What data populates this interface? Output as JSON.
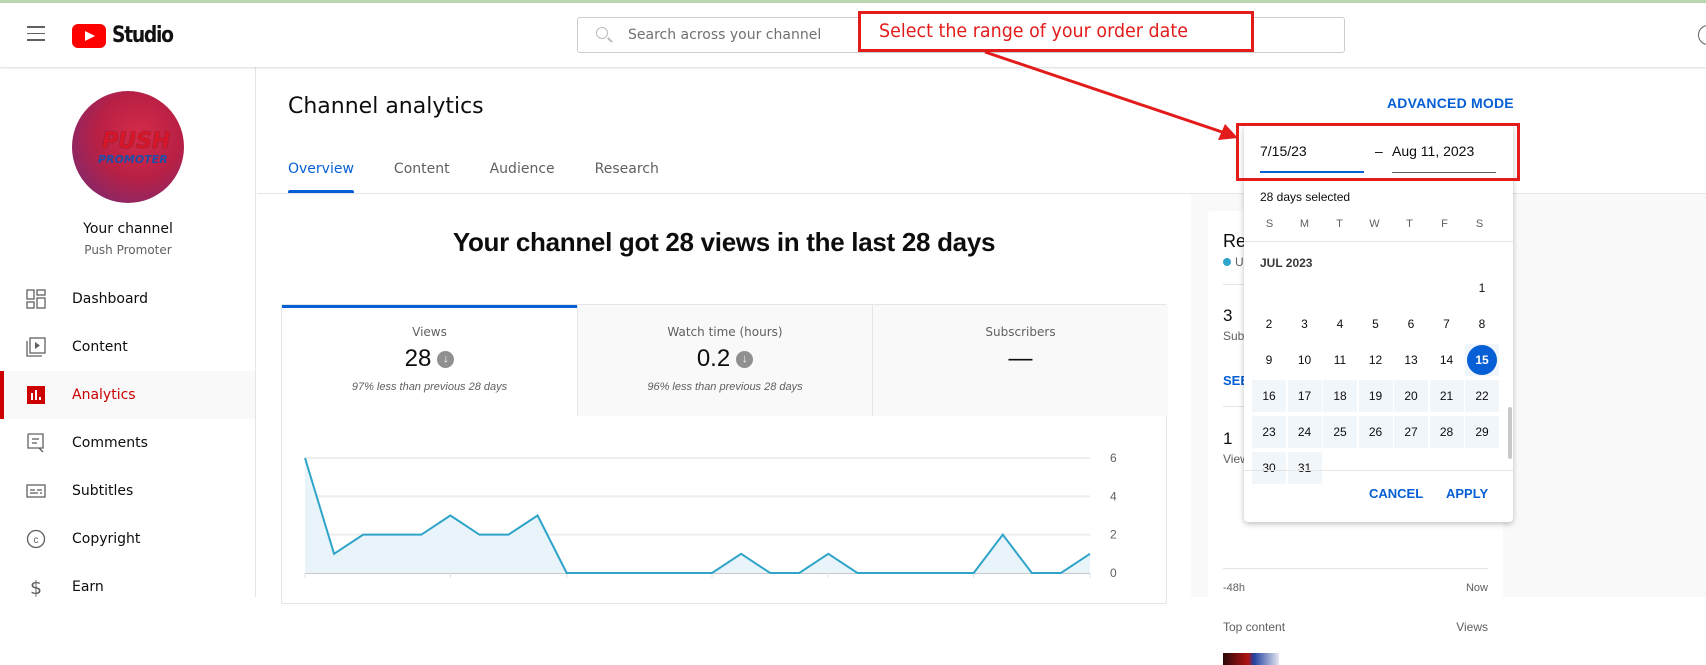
{
  "header": {
    "app_name": "Studio",
    "search_placeholder": "Search across your channel"
  },
  "annotation": {
    "text": "Select the range of your order date",
    "color": "#e31b1b"
  },
  "sidebar": {
    "channel_title": "Your channel",
    "channel_name": "Push Promoter",
    "avatar_text_1": "PUSH",
    "avatar_text_2": "PROMOTER",
    "items": [
      {
        "label": "Dashboard",
        "icon": "dashboard-icon",
        "active": false
      },
      {
        "label": "Content",
        "icon": "content-icon",
        "active": false
      },
      {
        "label": "Analytics",
        "icon": "analytics-icon",
        "active": true
      },
      {
        "label": "Comments",
        "icon": "comments-icon",
        "active": false
      },
      {
        "label": "Subtitles",
        "icon": "subtitles-icon",
        "active": false
      },
      {
        "label": "Copyright",
        "icon": "copyright-icon",
        "active": false
      },
      {
        "label": "Earn",
        "icon": "earn-icon",
        "active": false
      }
    ]
  },
  "main": {
    "title": "Channel analytics",
    "advanced_mode": "ADVANCED MODE",
    "tabs": [
      {
        "label": "Overview",
        "active": true
      },
      {
        "label": "Content",
        "active": false
      },
      {
        "label": "Audience",
        "active": false
      },
      {
        "label": "Research",
        "active": false
      }
    ],
    "headline": "Your channel got 28 views in the last 28 days",
    "metrics": [
      {
        "label": "Views",
        "value": "28",
        "trend": "down",
        "comparison": "97% less than previous 28 days"
      },
      {
        "label": "Watch time (hours)",
        "value": "0.2",
        "trend": "down",
        "comparison": "96% less than previous 28 days"
      },
      {
        "label": "Subscribers",
        "value": "—",
        "trend": "",
        "comparison": ""
      }
    ]
  },
  "realtime": {
    "title": "Re",
    "status": "Up",
    "subscribers_value": "3",
    "subscribers_label": "Sub",
    "see_more": "SEE",
    "views_value": "1",
    "views_label": "View",
    "x_start": "-48h",
    "x_end": "Now",
    "top_content_label": "Top content",
    "top_content_metric": "Views"
  },
  "date_picker": {
    "start_value": "7/15/23",
    "separator": "–",
    "end_value": "Aug 11, 2023",
    "days_selected": "28 days selected",
    "weekdays": [
      "S",
      "M",
      "T",
      "W",
      "T",
      "F",
      "S"
    ],
    "month_label": "JUL 2023",
    "month_first_weekday": 6,
    "month_days": 31,
    "selected_day": 15,
    "range_start": 15,
    "range_end": 31,
    "cancel_label": "CANCEL",
    "apply_label": "APPLY",
    "accent_color": "#065fd4"
  },
  "chart_data": {
    "type": "area",
    "title": "Views",
    "x": [
      1,
      2,
      3,
      4,
      5,
      6,
      7,
      8,
      9,
      10,
      11,
      12,
      13,
      14,
      15,
      16,
      17,
      18,
      19,
      20,
      21,
      22,
      23,
      24,
      25,
      26,
      27,
      28
    ],
    "values": [
      6,
      1,
      2,
      2,
      2,
      3,
      2,
      2,
      3,
      0,
      0,
      0,
      0,
      0,
      0,
      1,
      0,
      0,
      1,
      0,
      0,
      0,
      0,
      0,
      2,
      0,
      0,
      1
    ],
    "yticks": [
      0,
      2,
      4,
      6
    ],
    "ylim": [
      0,
      6
    ],
    "grid": true,
    "y_axis_side": "right",
    "line_color": "#2fa4c9",
    "fill_color": "#e8f4fa"
  }
}
